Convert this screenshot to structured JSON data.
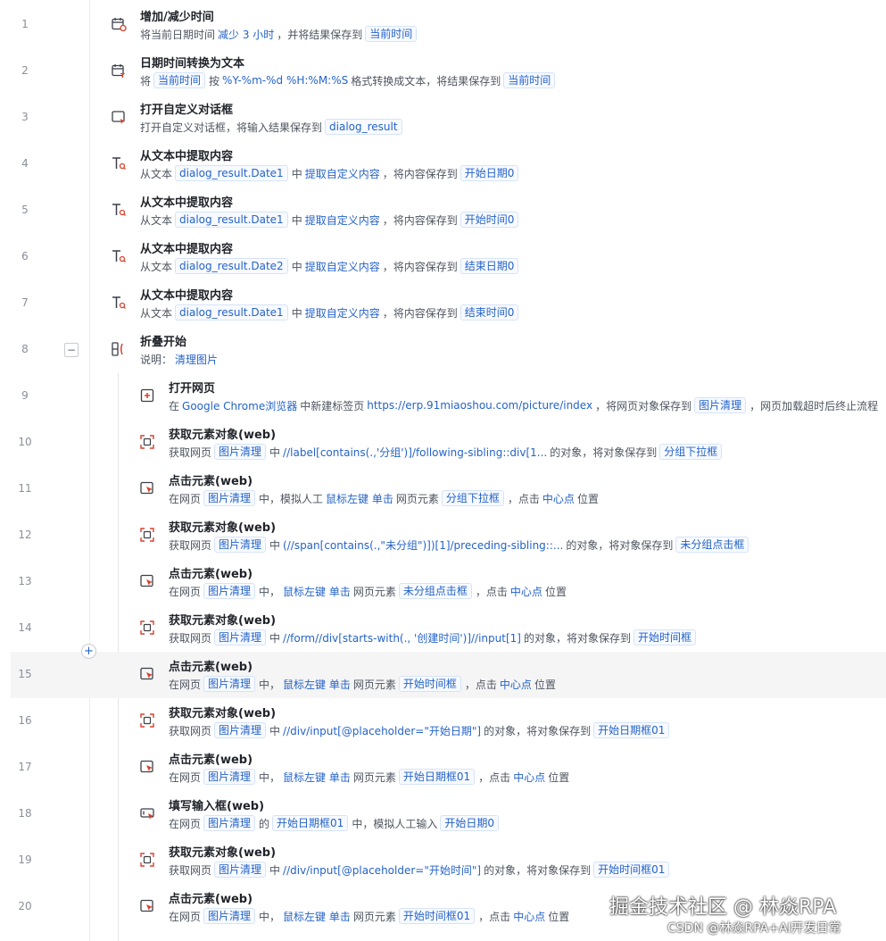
{
  "colors": {
    "accent": "#2563c9",
    "icon_red": "#d6402f",
    "icon_dark": "#3c4047",
    "highlight_row": "#f5f5f6"
  },
  "controls": {
    "collapse_symbol": "−",
    "add_symbol": "+"
  },
  "steps": [
    {
      "n": "1",
      "icon": "calendar-clock-icon",
      "title": "增加/减少时间",
      "indent": 0,
      "parts": [
        {
          "k": "t",
          "v": "将当前日期时间"
        },
        {
          "k": "kw",
          "v": "减少 3 小时"
        },
        {
          "k": "t",
          "v": "，并将结果保存到"
        },
        {
          "k": "tag",
          "v": "当前时间"
        }
      ]
    },
    {
      "n": "2",
      "icon": "calendar-text-icon",
      "title": "日期时间转换为文本",
      "indent": 0,
      "parts": [
        {
          "k": "t",
          "v": "将"
        },
        {
          "k": "tag",
          "v": "当前时间"
        },
        {
          "k": "t",
          "v": "按"
        },
        {
          "k": "kw",
          "v": "%Y-%m-%d %H:%M:%S"
        },
        {
          "k": "t",
          "v": "格式转换成文本，将结果保存到"
        },
        {
          "k": "tag",
          "v": "当前时间"
        }
      ]
    },
    {
      "n": "3",
      "icon": "dialog-icon",
      "title": "打开自定义对话框",
      "indent": 0,
      "parts": [
        {
          "k": "t",
          "v": "打开自定义对话框，将输入结果保存到"
        },
        {
          "k": "tag",
          "v": "dialog_result"
        }
      ]
    },
    {
      "n": "4",
      "icon": "text-extract-icon",
      "title": "从文本中提取内容",
      "indent": 0,
      "parts": [
        {
          "k": "t",
          "v": "从文本"
        },
        {
          "k": "tag",
          "v": "dialog_result.Date1"
        },
        {
          "k": "t",
          "v": "中"
        },
        {
          "k": "kw",
          "v": "提取自定义内容"
        },
        {
          "k": "t",
          "v": "，将内容保存到"
        },
        {
          "k": "tag",
          "v": "开始日期0"
        }
      ]
    },
    {
      "n": "5",
      "icon": "text-extract-icon",
      "title": "从文本中提取内容",
      "indent": 0,
      "parts": [
        {
          "k": "t",
          "v": "从文本"
        },
        {
          "k": "tag",
          "v": "dialog_result.Date1"
        },
        {
          "k": "t",
          "v": "中"
        },
        {
          "k": "kw",
          "v": "提取自定义内容"
        },
        {
          "k": "t",
          "v": "，将内容保存到"
        },
        {
          "k": "tag",
          "v": "开始时间0"
        }
      ]
    },
    {
      "n": "6",
      "icon": "text-extract-icon",
      "title": "从文本中提取内容",
      "indent": 0,
      "parts": [
        {
          "k": "t",
          "v": "从文本"
        },
        {
          "k": "tag",
          "v": "dialog_result.Date2"
        },
        {
          "k": "t",
          "v": "中"
        },
        {
          "k": "kw",
          "v": "提取自定义内容"
        },
        {
          "k": "t",
          "v": "，将内容保存到"
        },
        {
          "k": "tag",
          "v": "结束日期0"
        }
      ]
    },
    {
      "n": "7",
      "icon": "text-extract-icon",
      "title": "从文本中提取内容",
      "indent": 0,
      "parts": [
        {
          "k": "t",
          "v": "从文本"
        },
        {
          "k": "tag",
          "v": "dialog_result.Date1"
        },
        {
          "k": "t",
          "v": "中"
        },
        {
          "k": "kw",
          "v": "提取自定义内容"
        },
        {
          "k": "t",
          "v": "，将内容保存到"
        },
        {
          "k": "tag",
          "v": "结束时间0"
        }
      ]
    },
    {
      "n": "8",
      "icon": "fold-group-icon",
      "title": "折叠开始",
      "indent": 0,
      "parts": [
        {
          "k": "t",
          "v": "说明："
        },
        {
          "k": "kw",
          "v": "清理图片"
        }
      ]
    },
    {
      "n": "9",
      "icon": "open-webpage-icon",
      "title": "打开网页",
      "indent": 1,
      "parts": [
        {
          "k": "t",
          "v": "在"
        },
        {
          "k": "kw",
          "v": "Google Chrome浏览器"
        },
        {
          "k": "t",
          "v": "中新建标签页"
        },
        {
          "k": "kw",
          "v": "https://erp.91miaoshou.com/picture/index"
        },
        {
          "k": "t",
          "v": "，将网页对象保存到"
        },
        {
          "k": "tag",
          "v": "图片清理"
        },
        {
          "k": "t",
          "v": "，网页加载超时后终止流程"
        }
      ]
    },
    {
      "n": "10",
      "icon": "web-element-icon",
      "title": "获取元素对象(web)",
      "indent": 1,
      "parts": [
        {
          "k": "t",
          "v": "获取网页"
        },
        {
          "k": "tag",
          "v": "图片清理"
        },
        {
          "k": "t",
          "v": "中"
        },
        {
          "k": "kw",
          "v": "//label[contains(.,'分组')]/following-sibling::div[1..."
        },
        {
          "k": "t",
          "v": "的对象，将对象保存到"
        },
        {
          "k": "tag",
          "v": "分组下拉框"
        }
      ]
    },
    {
      "n": "11",
      "icon": "click-element-icon",
      "title": "点击元素(web)",
      "indent": 1,
      "parts": [
        {
          "k": "t",
          "v": "在网页"
        },
        {
          "k": "tag",
          "v": "图片清理"
        },
        {
          "k": "t",
          "v": "中，模拟人工"
        },
        {
          "k": "kw",
          "v": "鼠标左键 单击"
        },
        {
          "k": "t",
          "v": "网页元素"
        },
        {
          "k": "tag",
          "v": "分组下拉框"
        },
        {
          "k": "t",
          "v": "，点击"
        },
        {
          "k": "kw",
          "v": "中心点"
        },
        {
          "k": "t",
          "v": "位置"
        }
      ]
    },
    {
      "n": "12",
      "icon": "web-element-icon",
      "title": "获取元素对象(web)",
      "indent": 1,
      "parts": [
        {
          "k": "t",
          "v": "获取网页"
        },
        {
          "k": "tag",
          "v": "图片清理"
        },
        {
          "k": "t",
          "v": "中"
        },
        {
          "k": "kw",
          "v": "(//span[contains(.,\"未分组\")])[1]/preceding-sibling::..."
        },
        {
          "k": "t",
          "v": "的对象，将对象保存到"
        },
        {
          "k": "tag",
          "v": "未分组点击框"
        }
      ]
    },
    {
      "n": "13",
      "icon": "click-element-icon",
      "title": "点击元素(web)",
      "indent": 1,
      "parts": [
        {
          "k": "t",
          "v": "在网页"
        },
        {
          "k": "tag",
          "v": "图片清理"
        },
        {
          "k": "t",
          "v": "中，"
        },
        {
          "k": "kw",
          "v": "鼠标左键 单击"
        },
        {
          "k": "t",
          "v": "网页元素"
        },
        {
          "k": "tag",
          "v": "未分组点击框"
        },
        {
          "k": "t",
          "v": "，点击"
        },
        {
          "k": "kw",
          "v": "中心点"
        },
        {
          "k": "t",
          "v": "位置"
        }
      ]
    },
    {
      "n": "14",
      "icon": "web-element-icon",
      "title": "获取元素对象(web)",
      "indent": 1,
      "parts": [
        {
          "k": "t",
          "v": "获取网页"
        },
        {
          "k": "tag",
          "v": "图片清理"
        },
        {
          "k": "t",
          "v": "中"
        },
        {
          "k": "kw",
          "v": "//form//div[starts-with(., '创建时间')]//input[1]"
        },
        {
          "k": "t",
          "v": "的对象，将对象保存到"
        },
        {
          "k": "tag",
          "v": "开始时间框"
        }
      ]
    },
    {
      "n": "15",
      "icon": "click-element-icon",
      "title": "点击元素(web)",
      "indent": 1,
      "highlight": true,
      "parts": [
        {
          "k": "t",
          "v": "在网页"
        },
        {
          "k": "tag",
          "v": "图片清理"
        },
        {
          "k": "t",
          "v": "中，"
        },
        {
          "k": "kw",
          "v": "鼠标左键 单击"
        },
        {
          "k": "t",
          "v": "网页元素"
        },
        {
          "k": "tag",
          "v": "开始时间框"
        },
        {
          "k": "t",
          "v": "，点击"
        },
        {
          "k": "kw",
          "v": "中心点"
        },
        {
          "k": "t",
          "v": "位置"
        }
      ]
    },
    {
      "n": "16",
      "icon": "web-element-icon",
      "title": "获取元素对象(web)",
      "indent": 1,
      "parts": [
        {
          "k": "t",
          "v": "获取网页"
        },
        {
          "k": "tag",
          "v": "图片清理"
        },
        {
          "k": "t",
          "v": "中"
        },
        {
          "k": "kw",
          "v": "//div/input[@placeholder=\"开始日期\"]"
        },
        {
          "k": "t",
          "v": "的对象，将对象保存到"
        },
        {
          "k": "tag",
          "v": "开始日期框01"
        }
      ]
    },
    {
      "n": "17",
      "icon": "click-element-icon",
      "title": "点击元素(web)",
      "indent": 1,
      "parts": [
        {
          "k": "t",
          "v": "在网页"
        },
        {
          "k": "tag",
          "v": "图片清理"
        },
        {
          "k": "t",
          "v": "中，"
        },
        {
          "k": "kw",
          "v": "鼠标左键 单击"
        },
        {
          "k": "t",
          "v": "网页元素"
        },
        {
          "k": "tag",
          "v": "开始日期框01"
        },
        {
          "k": "t",
          "v": "，点击"
        },
        {
          "k": "kw",
          "v": "中心点"
        },
        {
          "k": "t",
          "v": "位置"
        }
      ]
    },
    {
      "n": "18",
      "icon": "fill-input-icon",
      "title": "填写输入框(web)",
      "indent": 1,
      "parts": [
        {
          "k": "t",
          "v": "在网页"
        },
        {
          "k": "tag",
          "v": "图片清理"
        },
        {
          "k": "t",
          "v": "的"
        },
        {
          "k": "tag",
          "v": "开始日期框01"
        },
        {
          "k": "t",
          "v": "中，模拟人工输入"
        },
        {
          "k": "tag",
          "v": "开始日期0"
        }
      ]
    },
    {
      "n": "19",
      "icon": "web-element-icon",
      "title": "获取元素对象(web)",
      "indent": 1,
      "parts": [
        {
          "k": "t",
          "v": "获取网页"
        },
        {
          "k": "tag",
          "v": "图片清理"
        },
        {
          "k": "t",
          "v": "中"
        },
        {
          "k": "kw",
          "v": "//div/input[@placeholder=\"开始时间\"]"
        },
        {
          "k": "t",
          "v": "的对象，将对象保存到"
        },
        {
          "k": "tag",
          "v": "开始时间框01"
        }
      ]
    },
    {
      "n": "20",
      "icon": "click-element-icon",
      "title": "点击元素(web)",
      "indent": 1,
      "parts": [
        {
          "k": "t",
          "v": "在网页"
        },
        {
          "k": "tag",
          "v": "图片清理"
        },
        {
          "k": "t",
          "v": "中，"
        },
        {
          "k": "kw",
          "v": "鼠标左键 单击"
        },
        {
          "k": "t",
          "v": "网页元素"
        },
        {
          "k": "tag",
          "v": "开始时间框01"
        },
        {
          "k": "t",
          "v": "，点击"
        },
        {
          "k": "kw",
          "v": "中心点"
        },
        {
          "k": "t",
          "v": "位置"
        }
      ]
    }
  ],
  "watermark": {
    "line1": "掘金技术社区 @ 林焱RPA",
    "line2": "CSDN @林焱RPA+AI开发日常"
  }
}
